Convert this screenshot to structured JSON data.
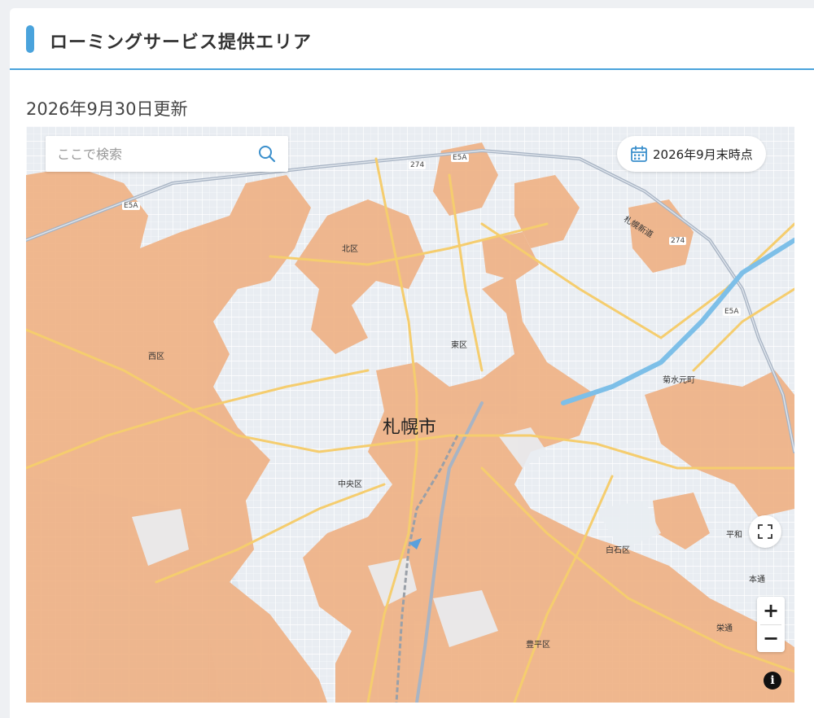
{
  "header": {
    "title": "ローミングサービス提供エリア"
  },
  "updated_text": "2026年9月30日更新",
  "map": {
    "search": {
      "placeholder": "ここで検索",
      "value": ""
    },
    "date_badge": "2026年9月末時点",
    "city_label": "札幌市",
    "district_labels": {
      "kita": "北区",
      "higashi": "東区",
      "nishi": "西区",
      "chuo": "中央区",
      "shiroishi": "白石区",
      "toyohira": "豊平区",
      "kikusui": "菊水元町",
      "heiwa": "平和",
      "hondori": "本通",
      "sakaedori": "栄通"
    },
    "road_labels": {
      "r274_a": "274",
      "r274_b": "274",
      "e5a_a": "E5A",
      "e5a_b": "E5A",
      "e5a_c": "E5A",
      "sapporo_shindo": "札幌新道"
    },
    "controls": {
      "zoom_in": "+",
      "zoom_out": "−",
      "info": "i"
    },
    "colors": {
      "coverage": "#efb286",
      "highway": "#a8b4c4",
      "main_road": "#f5cd6e",
      "river": "#7dbfe8",
      "accent": "#4aa3dc"
    }
  }
}
